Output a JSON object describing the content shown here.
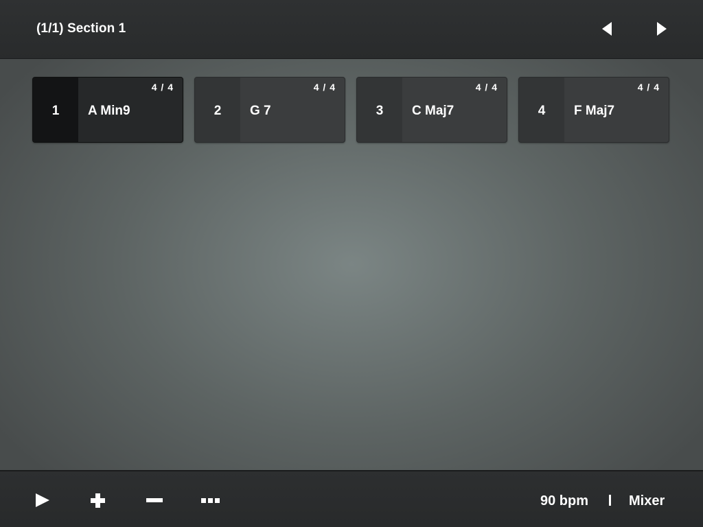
{
  "header": {
    "title": "(1/1) Section 1",
    "prev_icon": "triangle-left",
    "next_icon": "triangle-right"
  },
  "chords": [
    {
      "number": "1",
      "name": "A Min9",
      "meter": "4 / 4",
      "selected": true
    },
    {
      "number": "2",
      "name": "G 7",
      "meter": "4 / 4",
      "selected": false
    },
    {
      "number": "3",
      "name": "C Maj7",
      "meter": "4 / 4",
      "selected": false
    },
    {
      "number": "4",
      "name": "F Maj7",
      "meter": "4 / 4",
      "selected": false
    }
  ],
  "footer": {
    "tools": [
      "play-icon",
      "plus-icon",
      "minus-icon",
      "ellipsis-icon"
    ],
    "tempo": "90 bpm",
    "mixer_label": "Mixer"
  },
  "colors": {
    "accent_text": "#ffffff",
    "bar_background": "#2b2d2e",
    "chord_tile": "#3b3d3e",
    "chord_tile_selected": "#262829"
  }
}
